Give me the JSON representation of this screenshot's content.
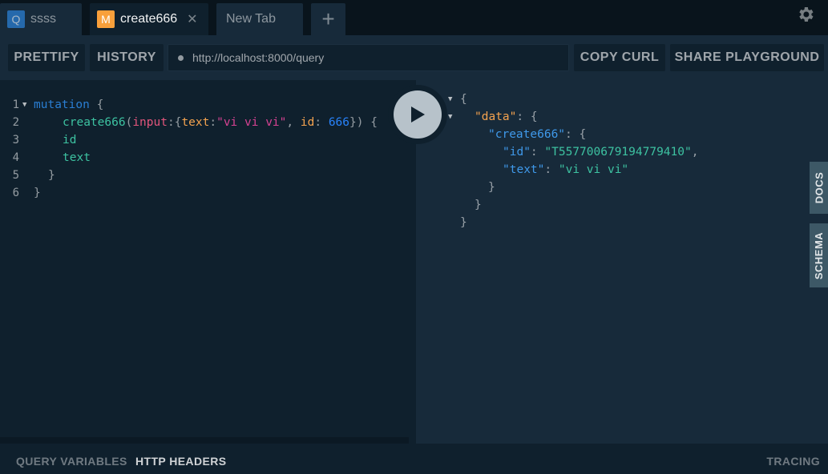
{
  "tabs": [
    {
      "badge": "Q",
      "label": "ssss"
    },
    {
      "badge": "M",
      "label": "create666",
      "close": "✕"
    },
    {
      "label": "New Tab"
    }
  ],
  "add_tab_label": "+",
  "toolbar": {
    "prettify_label": "PRETTIFY",
    "history_label": "HISTORY",
    "endpoint_url": "http://localhost:8000/query",
    "copy_curl_label": "COPY CURL",
    "share_label": "SHARE PLAYGROUND"
  },
  "query_editor": {
    "line_numbers": [
      "1",
      "2",
      "3",
      "4",
      "5",
      "6"
    ],
    "keyword": "mutation",
    "open_brace": "{",
    "field_name": "create666",
    "arg_name": "input",
    "text_key": "text",
    "text_value": "\"vi vi vi\"",
    "id_key": "id",
    "id_value": "666",
    "sub_field_1": "id",
    "sub_field_2": "text",
    "close_brace": "}"
  },
  "result": {
    "data_key": "\"data\"",
    "create_key": "\"create666\"",
    "id_key": "\"id\"",
    "id_value": "\"T557700679194779410\"",
    "text_key": "\"text\"",
    "text_value": "\"vi vi vi\""
  },
  "side_tabs": {
    "docs": "DOCS",
    "schema": "SCHEMA"
  },
  "bottom": {
    "query_variables": "QUERY VARIABLES",
    "http_headers": "HTTP HEADERS",
    "tracing": "TRACING"
  },
  "colors": {
    "background": "#0f202d",
    "accent_mutation": "#f9a03b",
    "accent_query": "#2a7ed3"
  },
  "icons": {
    "settings": "gear-icon",
    "play": "play-icon",
    "close": "close-icon",
    "add": "plus-icon"
  }
}
